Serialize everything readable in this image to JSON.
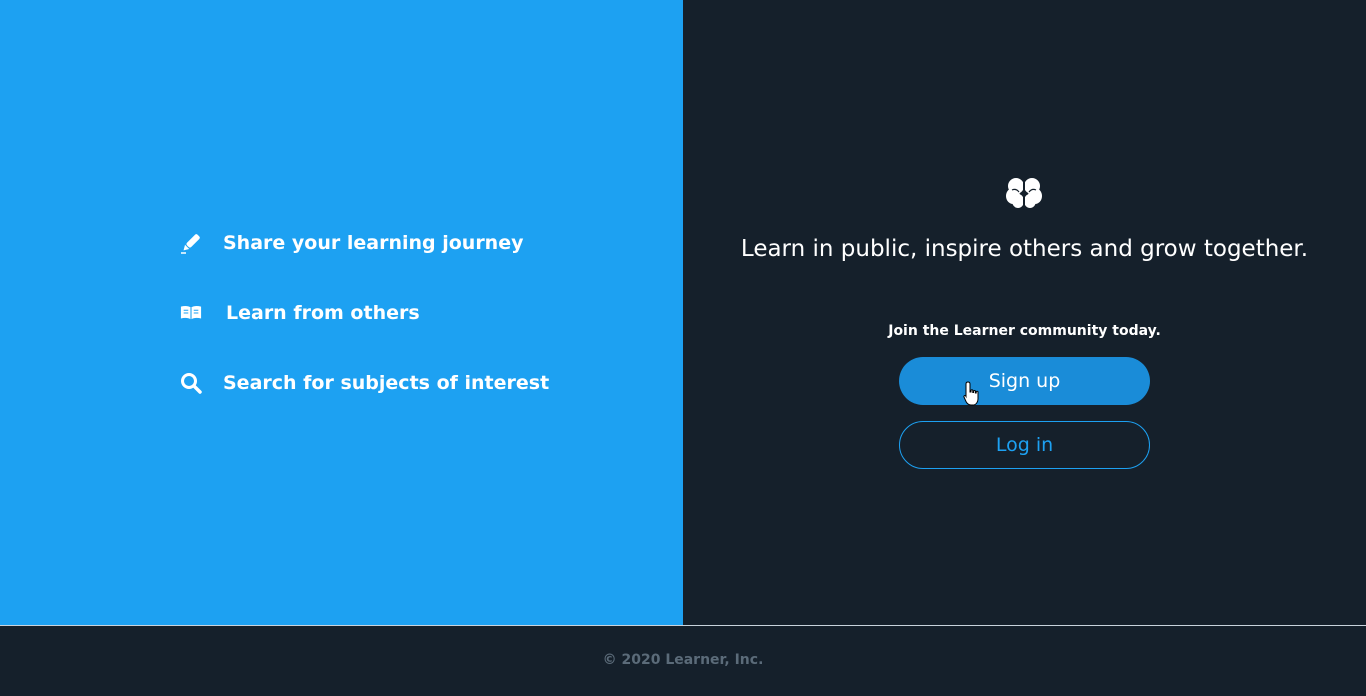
{
  "features": [
    {
      "icon": "pencil-icon",
      "label": "Share your learning journey"
    },
    {
      "icon": "book-open-icon",
      "label": "Learn from others"
    },
    {
      "icon": "search-icon",
      "label": "Search for subjects of interest"
    }
  ],
  "hero": {
    "logo_icon": "brain-icon",
    "headline": "Learn in public, inspire others and grow together.",
    "join_text": "Join the Learner community today."
  },
  "buttons": {
    "signup_label": "Sign up",
    "login_label": "Log in"
  },
  "footer": {
    "copyright": "© 2020 Learner, Inc."
  },
  "colors": {
    "brand_blue": "#1da1f2",
    "signup_blue": "#1a8cd8",
    "dark_bg": "#15202b"
  }
}
